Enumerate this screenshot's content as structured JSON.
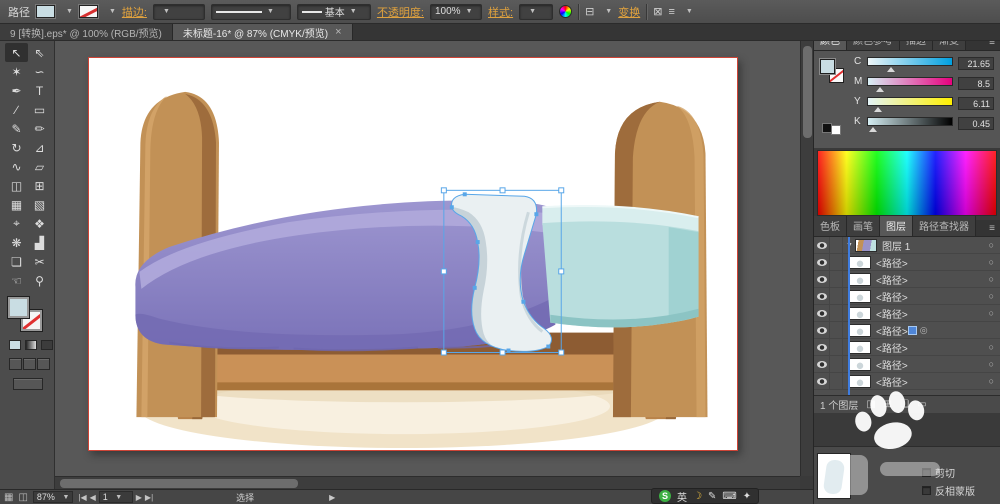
{
  "theme": {
    "accent_gold": "#e0a23e",
    "selection_blue": "#58a6e8",
    "current_fill": "#c9dde3",
    "panel_bg": "#535353"
  },
  "control_bar": {
    "object_label": "路径",
    "stroke_label": "描边:",
    "brush_value": "基本",
    "opacity_label": "不透明度:",
    "opacity_value": "100%",
    "style_label": "样式:",
    "transform_label": "变换"
  },
  "tabs": {
    "tab1": "9 [转换].eps* @ 100% (RGB/预览)",
    "tab2": "未标题-16* @ 87% (CMYK/预览)",
    "close": "×"
  },
  "tools": [
    {
      "g": "↖"
    },
    {
      "g": "⇖"
    },
    {
      "g": "✶"
    },
    {
      "g": "∽"
    },
    {
      "g": "✒"
    },
    {
      "g": "T"
    },
    {
      "g": "∕"
    },
    {
      "g": "▭"
    },
    {
      "g": "✎"
    },
    {
      "g": "✏"
    },
    {
      "g": "↻"
    },
    {
      "g": "⊿"
    },
    {
      "g": "∿"
    },
    {
      "g": "▱"
    },
    {
      "g": "◫"
    },
    {
      "g": "⊞"
    },
    {
      "g": "▦"
    },
    {
      "g": "▧"
    },
    {
      "g": "⌖"
    },
    {
      "g": "❖"
    },
    {
      "g": "❋"
    },
    {
      "g": "▟"
    },
    {
      "g": "❏"
    },
    {
      "g": "✂"
    },
    {
      "g": "☜"
    },
    {
      "g": "⚲"
    }
  ],
  "right_panel": {
    "tabs1": {
      "t0": "颜色",
      "t1": "颜色参考",
      "t2": "描边",
      "t3": "渐变"
    },
    "color": {
      "rows": [
        {
          "ch": "C",
          "val": "21.65"
        },
        {
          "ch": "M",
          "val": "8.5"
        },
        {
          "ch": "Y",
          "val": "6.11"
        },
        {
          "ch": "K",
          "val": "0.45"
        }
      ]
    },
    "tabs2": {
      "t0": "色板",
      "t1": "画笔",
      "t2": "图层",
      "t3": "路径查找器"
    },
    "layers": {
      "rows": [
        {
          "name": "图层 1"
        },
        {
          "name": "<路径>"
        },
        {
          "name": "<路径>"
        },
        {
          "name": "<路径>"
        },
        {
          "name": "<路径>"
        },
        {
          "name": "<路径>"
        },
        {
          "name": "<路径>"
        },
        {
          "name": "<路径>"
        },
        {
          "name": "<路径>"
        }
      ],
      "footer": "1 个图层"
    },
    "transparency": {
      "clip": "剪切",
      "invert": "反相蒙版"
    }
  },
  "status_bar": {
    "zoom": "87%",
    "artboard": "1",
    "tool": "选择"
  },
  "ime": {
    "logo": "S",
    "lang": "英"
  }
}
